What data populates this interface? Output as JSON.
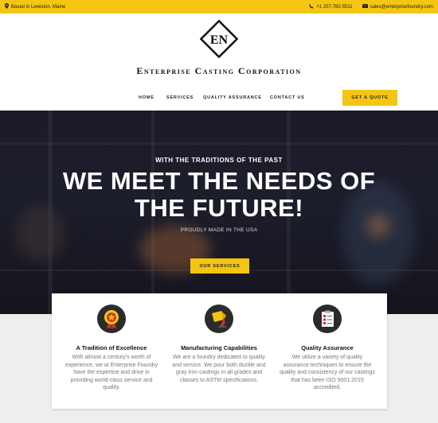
{
  "topbar": {
    "location": "Based in Lewiston, Maine",
    "phone": "+1 207-782-5511",
    "email": "sales@enterprisefoundry.com",
    "background": "#f4c513"
  },
  "header": {
    "logo_letters": "EN",
    "brand_name": "Enterprise Casting Corporation"
  },
  "nav": {
    "items": [
      "HOME",
      "SERVICES",
      "QUALITY ASSURANCE",
      "CONTACT US"
    ],
    "cta": "GET A QUOTE"
  },
  "hero": {
    "subtitle": "WITH THE TRADITIONS OF THE PAST",
    "title_line1": "WE MEET THE NEEDS OF",
    "title_line2": "THE FUTURE!",
    "tagline": "PROUDLY MADE IN THE USA",
    "button": "OUR SERVICES"
  },
  "features": [
    {
      "icon": "award-medal-icon",
      "title": "A Tradition of Excellence",
      "text": "With almost a century's worth of experience, we at Enterprise Foundry have the expertise and drive in providing world-class service and quality."
    },
    {
      "icon": "molten-pour-icon",
      "title": "Manufacturing Capabilities",
      "text": "We are a foundry dedicated to quality and service. We pour both ductile and gray iron castings in all grades and classes to ASTM specifications."
    },
    {
      "icon": "checklist-icon",
      "title": "Quality Assurance",
      "text": "We utilize a variety of quality assurance techniques to ensure the quality and consistency of our castings that has been ISO 9001:2015 accredited."
    }
  ],
  "colors": {
    "accent": "#f4c513",
    "hero_dark": "#1c1a26"
  }
}
